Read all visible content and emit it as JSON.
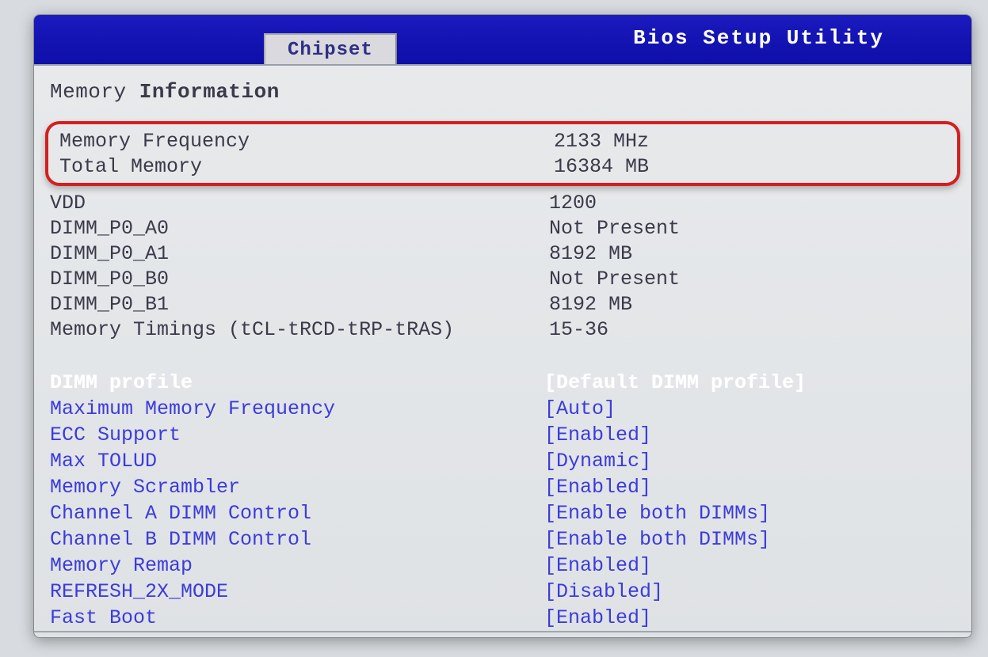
{
  "header": {
    "title": "Bios Setup Utility",
    "active_tab": "Chipset"
  },
  "section": {
    "title_prefix": "Memory ",
    "title_bold": "Information"
  },
  "highlighted": [
    {
      "label": "Memory Frequency",
      "value": "2133 MHz"
    },
    {
      "label": "Total Memory",
      "value": "16384 MB"
    }
  ],
  "info_rows": [
    {
      "label": "VDD",
      "value": "1200"
    },
    {
      "label": "DIMM_P0_A0",
      "value": "Not Present"
    },
    {
      "label": "DIMM_P0_A1",
      "value": "8192 MB"
    },
    {
      "label": "DIMM_P0_B0",
      "value": "Not Present"
    },
    {
      "label": "DIMM_P0_B1",
      "value": "8192 MB"
    },
    {
      "label": "Memory Timings (tCL-tRCD-tRP-tRAS)",
      "value": "15-36"
    }
  ],
  "selected_setting": {
    "label": "DIMM profile",
    "value": "[Default DIMM profile]"
  },
  "settings": [
    {
      "label": "Maximum Memory Frequency",
      "value": "[Auto]"
    },
    {
      "label": "ECC Support",
      "value": "[Enabled]"
    },
    {
      "label": "Max TOLUD",
      "value": "[Dynamic]"
    },
    {
      "label": "Memory Scrambler",
      "value": "[Enabled]"
    },
    {
      "label": "Channel A DIMM Control",
      "value": "[Enable both DIMMs]"
    },
    {
      "label": "Channel B DIMM Control",
      "value": "[Enable both DIMMs]"
    },
    {
      "label": "Memory Remap",
      "value": "[Enabled]"
    },
    {
      "label": "REFRESH_2X_MODE",
      "value": "[Disabled]"
    },
    {
      "label": "Fast Boot",
      "value": "[Enabled]"
    }
  ]
}
